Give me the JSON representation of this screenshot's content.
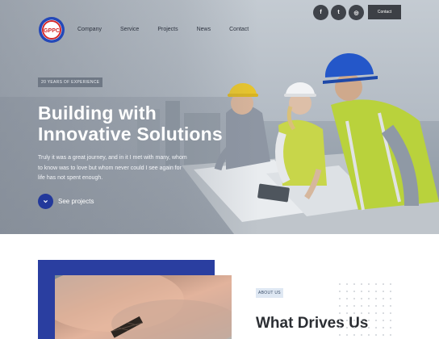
{
  "nav": {
    "logo_text": "GPPC",
    "items": [
      "Company",
      "Service",
      "Projects",
      "News",
      "Contact"
    ],
    "social": [
      {
        "icon": "facebook-icon",
        "glyph": "f"
      },
      {
        "icon": "twitter-icon",
        "glyph": "t"
      },
      {
        "icon": "instagram-icon",
        "glyph": "◎"
      }
    ],
    "contact_button": "Contact"
  },
  "hero": {
    "badge": "20 YEARS OF EXPERIENCE",
    "title_line1": "Building with",
    "title_line2": "Innovative Solutions",
    "description": "Truly it was a great journey, and in it I met with many, whom to know was to love but whom never could I see again for life has not spent enough.",
    "cta_label": "See projects",
    "cta_icon": "chevron-down-icon"
  },
  "about": {
    "badge": "ABOUT US",
    "title": "What Drives Us"
  },
  "colors": {
    "primary_blue": "#2a3ea0",
    "dark": "#3d4046",
    "logo_red": "#d42b2b",
    "logo_blue": "#2448b8"
  }
}
